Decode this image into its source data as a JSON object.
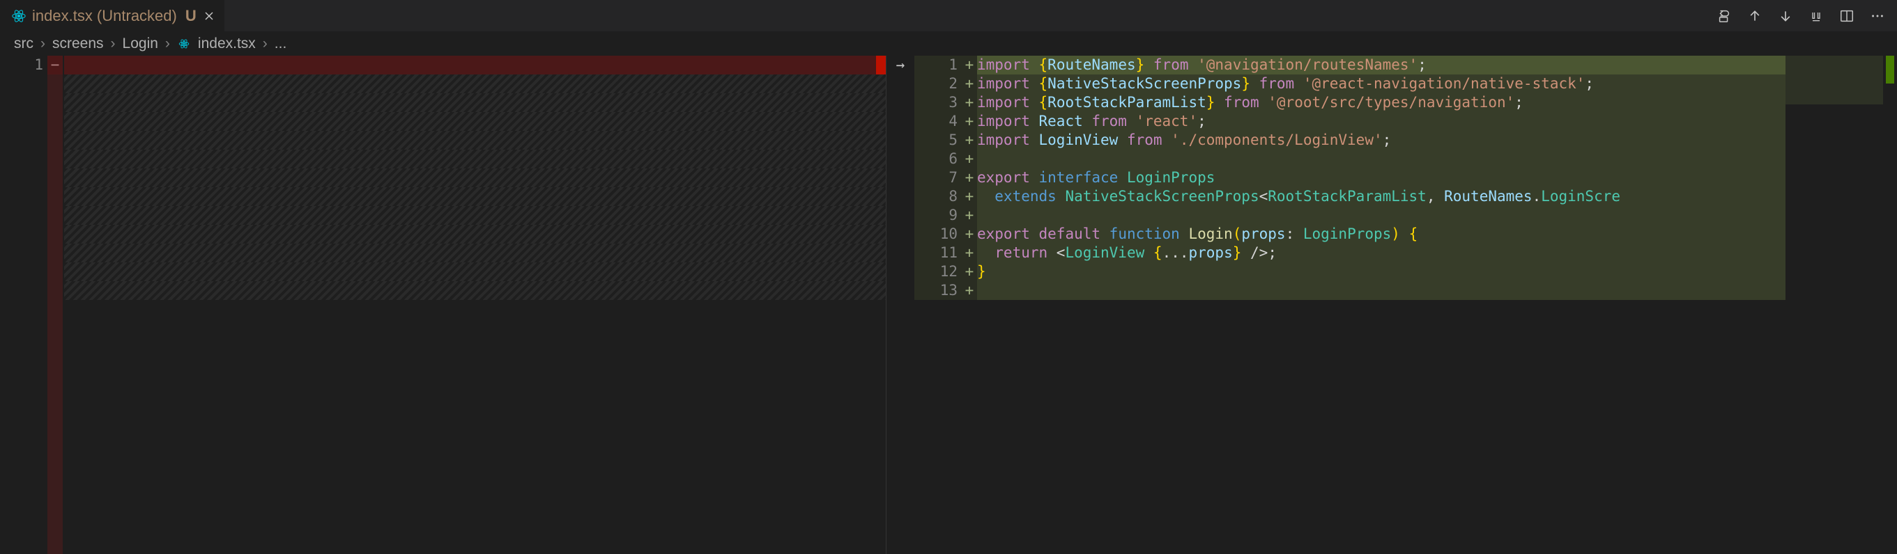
{
  "tab": {
    "title": "index.tsx (Untracked)",
    "status": "U"
  },
  "breadcrumb": {
    "segments": [
      "src",
      "screens",
      "Login"
    ],
    "file": "index.tsx",
    "trail": "..."
  },
  "left": {
    "lines": [
      {
        "num": 1,
        "sign": "−",
        "removed": true
      }
    ]
  },
  "right": {
    "lines": [
      {
        "num": 1,
        "sign": "+",
        "tokens": [
          {
            "t": "import ",
            "c": "kw"
          },
          {
            "t": "{",
            "c": "brace"
          },
          {
            "t": "RouteNames",
            "c": "var"
          },
          {
            "t": "}",
            "c": "brace"
          },
          {
            "t": " from ",
            "c": "kw"
          },
          {
            "t": "'@navigation/routesNames'",
            "c": "str"
          },
          {
            "t": ";",
            "c": "punct"
          }
        ]
      },
      {
        "num": 2,
        "sign": "+",
        "tokens": [
          {
            "t": "import ",
            "c": "kw"
          },
          {
            "t": "{",
            "c": "brace"
          },
          {
            "t": "NativeStackScreenProps",
            "c": "var"
          },
          {
            "t": "}",
            "c": "brace"
          },
          {
            "t": " from ",
            "c": "kw"
          },
          {
            "t": "'@react-navigation/native-stack'",
            "c": "str"
          },
          {
            "t": ";",
            "c": "punct"
          }
        ]
      },
      {
        "num": 3,
        "sign": "+",
        "tokens": [
          {
            "t": "import ",
            "c": "kw"
          },
          {
            "t": "{",
            "c": "brace"
          },
          {
            "t": "RootStackParamList",
            "c": "var"
          },
          {
            "t": "}",
            "c": "brace"
          },
          {
            "t": " from ",
            "c": "kw"
          },
          {
            "t": "'@root/src/types/navigation'",
            "c": "str"
          },
          {
            "t": ";",
            "c": "punct"
          }
        ]
      },
      {
        "num": 4,
        "sign": "+",
        "tokens": [
          {
            "t": "import ",
            "c": "kw"
          },
          {
            "t": "React",
            "c": "var"
          },
          {
            "t": " from ",
            "c": "kw"
          },
          {
            "t": "'react'",
            "c": "str"
          },
          {
            "t": ";",
            "c": "punct"
          }
        ]
      },
      {
        "num": 5,
        "sign": "+",
        "tokens": [
          {
            "t": "import ",
            "c": "kw"
          },
          {
            "t": "LoginView",
            "c": "var"
          },
          {
            "t": " from ",
            "c": "kw"
          },
          {
            "t": "'./components/LoginView'",
            "c": "str"
          },
          {
            "t": ";",
            "c": "punct"
          }
        ]
      },
      {
        "num": 6,
        "sign": "+",
        "tokens": []
      },
      {
        "num": 7,
        "sign": "+",
        "tokens": [
          {
            "t": "export ",
            "c": "kw"
          },
          {
            "t": "interface ",
            "c": "kw2"
          },
          {
            "t": "LoginProps",
            "c": "type"
          }
        ]
      },
      {
        "num": 8,
        "sign": "+",
        "tokens": [
          {
            "t": "  extends ",
            "c": "kw2"
          },
          {
            "t": "NativeStackScreenProps",
            "c": "type"
          },
          {
            "t": "<",
            "c": "punct"
          },
          {
            "t": "RootStackParamList",
            "c": "type"
          },
          {
            "t": ", ",
            "c": "punct"
          },
          {
            "t": "RouteNames",
            "c": "var"
          },
          {
            "t": ".",
            "c": "punct"
          },
          {
            "t": "LoginScre",
            "c": "type"
          }
        ]
      },
      {
        "num": 9,
        "sign": "+",
        "tokens": []
      },
      {
        "num": 10,
        "sign": "+",
        "tokens": [
          {
            "t": "export ",
            "c": "kw"
          },
          {
            "t": "default ",
            "c": "kw"
          },
          {
            "t": "function ",
            "c": "kw2"
          },
          {
            "t": "Login",
            "c": "fn"
          },
          {
            "t": "(",
            "c": "brace"
          },
          {
            "t": "props",
            "c": "var"
          },
          {
            "t": ": ",
            "c": "punct"
          },
          {
            "t": "LoginProps",
            "c": "type"
          },
          {
            "t": ")",
            "c": "brace"
          },
          {
            "t": " ",
            "c": "punct"
          },
          {
            "t": "{",
            "c": "brace"
          }
        ]
      },
      {
        "num": 11,
        "sign": "+",
        "tokens": [
          {
            "t": "  return ",
            "c": "kw"
          },
          {
            "t": "<",
            "c": "punct"
          },
          {
            "t": "LoginView",
            "c": "tag"
          },
          {
            "t": " ",
            "c": "punct"
          },
          {
            "t": "{",
            "c": "brace"
          },
          {
            "t": "...",
            "c": "punct"
          },
          {
            "t": "props",
            "c": "var"
          },
          {
            "t": "}",
            "c": "brace"
          },
          {
            "t": " />",
            "c": "punct"
          },
          {
            "t": ";",
            "c": "punct"
          }
        ]
      },
      {
        "num": 12,
        "sign": "+",
        "tokens": [
          {
            "t": "}",
            "c": "brace"
          }
        ]
      },
      {
        "num": 13,
        "sign": "+",
        "tokens": []
      }
    ]
  },
  "arrow": "→"
}
